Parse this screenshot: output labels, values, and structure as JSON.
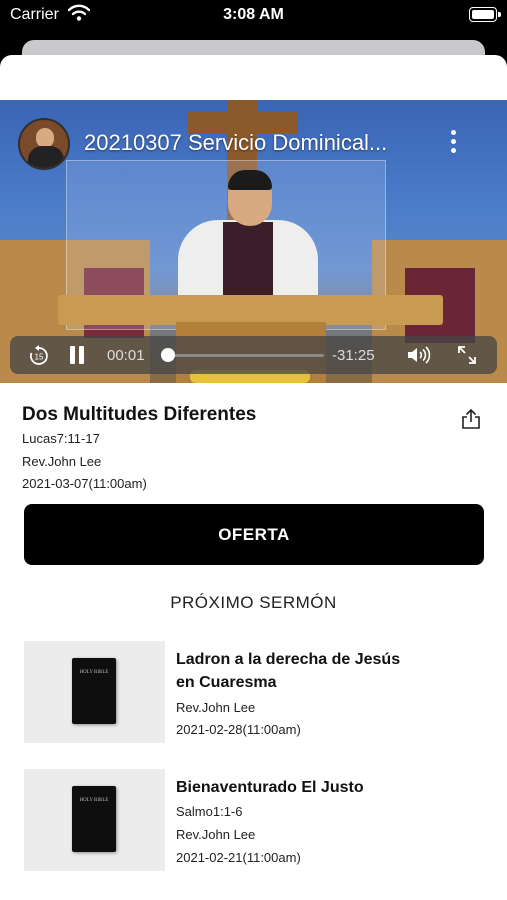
{
  "status": {
    "carrier": "Carrier",
    "time": "3:08 AM"
  },
  "video": {
    "title": "20210307 Servicio Dominical...",
    "elapsed": "00:01",
    "remaining": "-31:25",
    "progress": 0.01
  },
  "sermon": {
    "title": "Dos Multitudes Diferentes",
    "passage": "Lucas7:11-17",
    "preacher": "Rev.John Lee",
    "date": "2021-03-07(11:00am)"
  },
  "offer_button": "OFERTA",
  "next_heading": "PRÓXIMO SERMÓN",
  "next_sermons": [
    {
      "title_line1": "Ladron a la derecha de Jesús",
      "title_line2": "en Cuaresma",
      "preacher": "Rev.John Lee",
      "date": "2021-02-28(11:00am)",
      "cover_text": "HOLY BIBLE"
    },
    {
      "title_line1": "Bienaventurado El Justo",
      "passage": "Salmo1:1-6",
      "preacher": "Rev.John Lee",
      "date": "2021-02-21(11:00am)",
      "cover_text": "HOLY BIBLE"
    }
  ],
  "colors": {
    "button_bg": "#000000",
    "button_text": "#ffffff",
    "thumb_bg": "#ececec"
  }
}
